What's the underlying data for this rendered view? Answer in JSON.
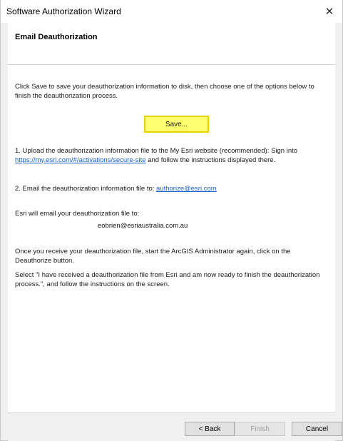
{
  "window": {
    "title": "Software Authorization Wizard",
    "close_glyph": "✕"
  },
  "header": {
    "title": "Email Deauthorization"
  },
  "content": {
    "intro": "Click Save to save your deauthorization information to disk, then choose one of the options below to finish the deauthorization process.",
    "save_label": "Save...",
    "option1_text": "1.  Upload the deauthorization information file to the My Esri website (recommended): Sign into",
    "option1_link": "https://my.esri.com/#/activations/secure-site",
    "option1_suffix": " and follow the instructions displayed there.",
    "option2_text": "2.  Email the deauthorization information file to: ",
    "option2_link": "authorize@esri.com",
    "esri_email_label": "Esri will email your deauthorization file to:",
    "user_email": "eobrien@esriaustralia.com.au",
    "receive_text": "Once you receive your deauthorization file, start the ArcGIS Administrator again, click on the Deauthorize button.",
    "select_text": "Select \"I have received a deauthorization file from Esri and am now ready to finish the deauthorization process.\", and follow the instructions on the screen."
  },
  "footer": {
    "back_label": "< Back",
    "finish_label": "Finish",
    "cancel_label": "Cancel"
  }
}
